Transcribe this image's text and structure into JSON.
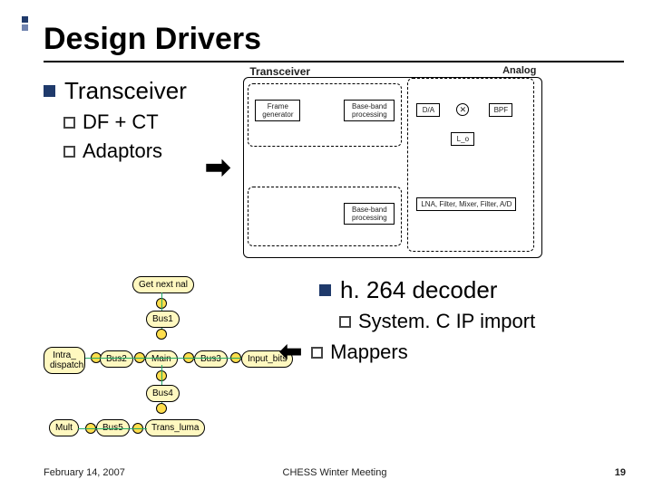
{
  "title": "Design Drivers",
  "transceiver": {
    "heading": "Transceiver",
    "sub1": "DF + CT",
    "sub2": "Adaptors"
  },
  "decoder": {
    "heading": "h. 264 decoder",
    "sub1": "System. C IP import",
    "sub2": "Mappers"
  },
  "trx_diagram": {
    "label": "Transceiver",
    "analog": "Analog",
    "frame": "Frame generator",
    "bb1": "Base-band processing",
    "bb2": "Base-band processing",
    "da": "D/A",
    "bpf": "BPF",
    "lo": "L_o",
    "rx": "LNA, Filter, Mixer, Filter, A/D"
  },
  "dec_diagram": {
    "get_next": "Get next nal",
    "bus1": "Bus1",
    "intra": "Intra_ dispatch",
    "bus2": "Bus2",
    "main": "Main",
    "bus3": "Bus3",
    "input_bits": "Input_bits",
    "bus4": "Bus4",
    "mult": "Mult",
    "bus5": "Bus5",
    "trans": "Trans_luma"
  },
  "footer": {
    "date": "February 14, 2007",
    "center": "CHESS Winter Meeting",
    "page": "19"
  }
}
